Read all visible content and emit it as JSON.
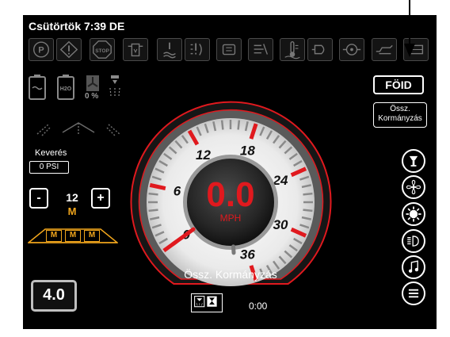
{
  "header": {
    "datetime": "Csütörtök 7:39 DE"
  },
  "alarm_icons": [
    "parking-brake-icon",
    "warning-icon",
    "stop-icon",
    "fuel-filter-icon",
    "coolant-level-icon",
    "hydraulic-warning-icon",
    "transmission-warning-icon",
    "air-filter-icon",
    "coolant-temperature-icon",
    "hydraulic-filter-icon",
    "engine-filter-icon",
    "oil-pressure-icon",
    "engine-stop-icon"
  ],
  "status": {
    "fan_percent": "0 %",
    "mix_label": "Keverés",
    "pressure_value": "0 PSI",
    "nozzle_value": "12",
    "nozzle_mode": "M",
    "boom_sections": [
      "M",
      "M",
      "M"
    ],
    "decrement_label": "-",
    "increment_label": "+"
  },
  "speedometer": {
    "speed": "0.0",
    "unit": "MPH",
    "tick_labels": [
      "0",
      "6",
      "12",
      "18",
      "24",
      "30",
      "36"
    ],
    "min": 0,
    "max": 36,
    "value": 0.0,
    "label": "Össz. Kormányzás"
  },
  "buttons": {
    "ground_label": "FÖID",
    "total_steer_line1": "Össz.",
    "total_steer_line2": "Kormányzás"
  },
  "bottom": {
    "level_value": "4.0",
    "timer": "0:00"
  },
  "right_icons": [
    "spray-valve-icon",
    "fan-icon",
    "work-light-icon",
    "headlight-icon",
    "music-icon",
    "menu-icon"
  ],
  "colors": {
    "accent": "#e0191e",
    "boom": "#f0a51c",
    "background": "#000000"
  }
}
